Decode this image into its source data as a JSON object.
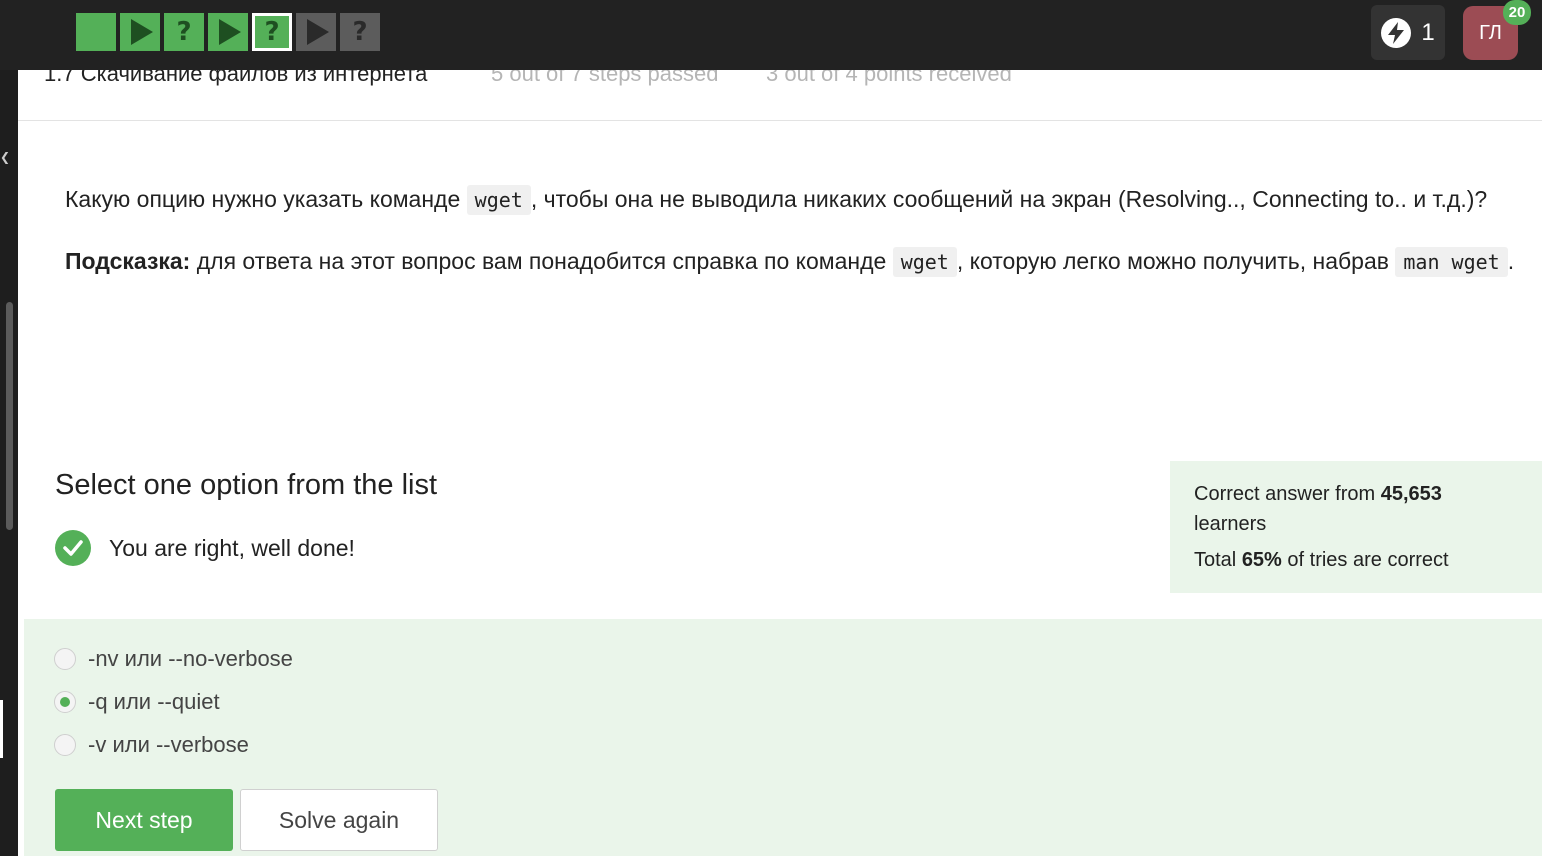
{
  "topbar": {
    "steps": [
      {
        "kind": "solid",
        "state": "passed"
      },
      {
        "kind": "play",
        "state": "passed"
      },
      {
        "kind": "question",
        "state": "passed",
        "glyph": "?"
      },
      {
        "kind": "play",
        "state": "passed"
      },
      {
        "kind": "question",
        "state": "current",
        "glyph": "?"
      },
      {
        "kind": "play",
        "state": "locked"
      },
      {
        "kind": "question",
        "state": "locked",
        "glyph": "?"
      }
    ],
    "energy_count": "1",
    "avatar_initials": "ГЛ",
    "avatar_badge": "20",
    "colors": {
      "accent": "#54b058",
      "bar": "#222222",
      "avatar": "#9c4c54"
    }
  },
  "lesson": {
    "title": "1.7 Скачивание файлов из интернета",
    "progress": "5 out of 7 steps passed",
    "points": "3 out of 4 points  received"
  },
  "question": {
    "p1_before": "Какую опцию нужно указать команде ",
    "p1_code": "wget",
    "p1_after": ", чтобы она не выводила никаких сообщений на экран (Resolving.., Connecting to.. и т.д.)?",
    "hint_label": "Подсказка:",
    "hint_before": " для ответа на этот вопрос вам понадобится справка по команде ",
    "hint_code1": "wget",
    "hint_middle": ", которую легко можно получить, набрав ",
    "hint_code2": "man wget",
    "hint_after": "."
  },
  "quiz": {
    "heading": "Select one option from the list",
    "result": "You are right, well done!",
    "stats": {
      "line1_before": "Correct answer from ",
      "learners": "45,653",
      "line1_after": " learners",
      "line2_before": "Total ",
      "percent": "65%",
      "line2_after": " of tries are correct"
    },
    "options": [
      {
        "label": "-nv или --no-verbose",
        "selected": false
      },
      {
        "label": "-q или --quiet",
        "selected": true
      },
      {
        "label": "-v или --verbose",
        "selected": false
      }
    ],
    "next_button": "Next step",
    "again_button": "Solve again"
  }
}
